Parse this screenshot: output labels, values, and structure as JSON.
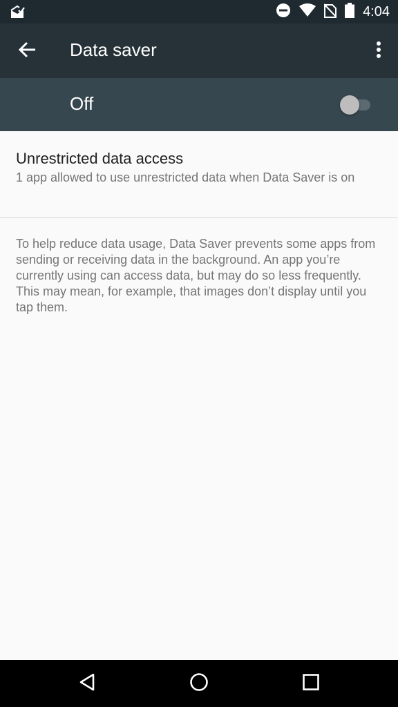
{
  "status_bar": {
    "time": "4:04",
    "icons": [
      "notification-mail-icon",
      "do-not-disturb-icon",
      "wifi-icon",
      "no-sim-icon",
      "battery-icon"
    ]
  },
  "app_bar": {
    "title": "Data saver",
    "back_icon": "arrow-back-icon",
    "menu_icon": "more-vert-icon",
    "background": "#263238"
  },
  "master_switch": {
    "label": "Off",
    "state": "off",
    "background": "#37474f"
  },
  "unrestricted_item": {
    "title": "Unrestricted data access",
    "summary": "1 app allowed to use unrestricted data when Data Saver is on"
  },
  "description": "To help reduce data usage, Data Saver prevents some apps from sending or receiving data in the background. An app you’re currently using can access data, but may do so less frequently. This may mean, for example, that images don’t display until you tap them.",
  "nav_bar": {
    "icons": [
      "back-triangle-icon",
      "home-circle-icon",
      "recents-square-icon"
    ]
  }
}
